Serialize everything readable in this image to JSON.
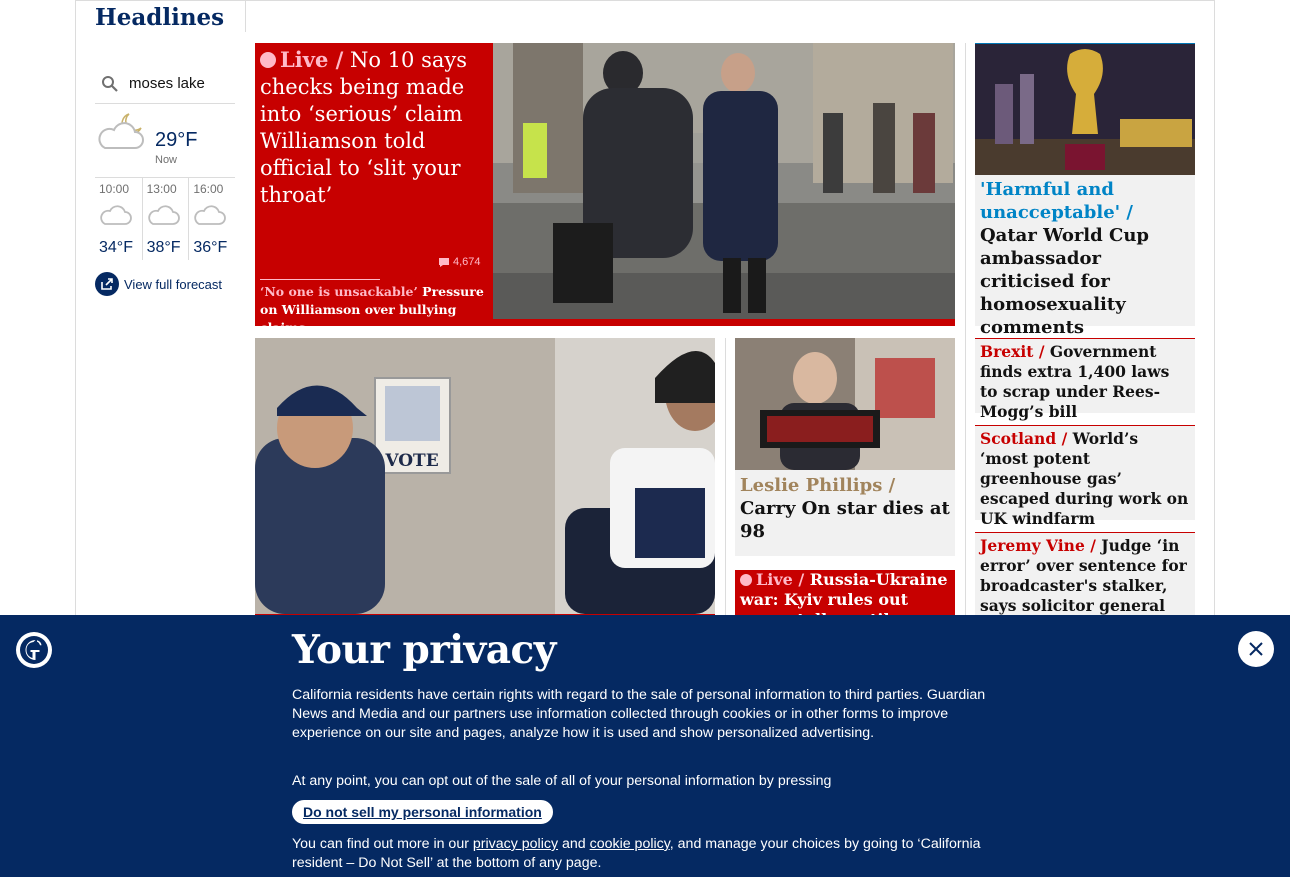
{
  "section": {
    "title": "Headlines"
  },
  "weather": {
    "location": "moses lake",
    "now_label": "Now",
    "now_temp": "29°F",
    "forecast": [
      {
        "time": "10:00",
        "temp": "34°F"
      },
      {
        "time": "13:00",
        "temp": "38°F"
      },
      {
        "time": "16:00",
        "temp": "36°F"
      }
    ],
    "full_forecast_label": "View full forecast"
  },
  "main_story": {
    "kicker": "Live /",
    "headline": "No 10 says checks being made into ‘serious’ claim Williamson told official to ‘slit your throat’",
    "comments": "4,674",
    "sub_kicker": "‘No one is unsackable’",
    "sub_headline": "Pressure on Williamson over bullying claims"
  },
  "leslie_story": {
    "kicker": "Leslie Phillips /",
    "headline": "Carry On star dies at 98"
  },
  "russia_story": {
    "kicker": "Live /",
    "headline": "Russia-Ukraine war: Kyiv rules out peace talks until Russia..."
  },
  "qatar_story": {
    "kicker": "'Harmful and unacceptable' /",
    "headline": "Qatar World Cup ambassador criticised for homosexuality comments"
  },
  "side_stories": [
    {
      "kicker": "Brexit /",
      "headline": "Government finds extra 1,400 laws to scrap under Rees-Mogg’s bill"
    },
    {
      "kicker": "Scotland /",
      "headline": "World’s ‘most potent greenhouse gas’ escaped during work on UK windfarm"
    },
    {
      "kicker": "Jeremy Vine  /",
      "headline": "Judge ‘in error’ over sentence for broadcaster's stalker, says solicitor general"
    }
  ],
  "vote_image_text": "VOTE",
  "privacy": {
    "title": "Your privacy",
    "para1": "California residents have certain rights with regard to the sale of personal information to third parties. Guardian News and Media and our partners use information collected through cookies or in other forms to improve experience on our site and pages, analyze how it is used and show personalized advertising.",
    "para2": "At any point, you can opt out of the sale of all of your personal information by pressing",
    "button": "Do not sell my personal information",
    "para3_a": "You can find out more in our ",
    "privacy_link": "privacy policy",
    "para3_b": " and ",
    "cookie_link": "cookie policy",
    "para3_c": ", and manage your choices by going to ‘California resident – Do Not Sell’ at the bottom of any page."
  },
  "colors": {
    "brand": "#052962",
    "news_red": "#c70000",
    "sport_blue": "#0084c6",
    "culture": "#a1845c"
  }
}
